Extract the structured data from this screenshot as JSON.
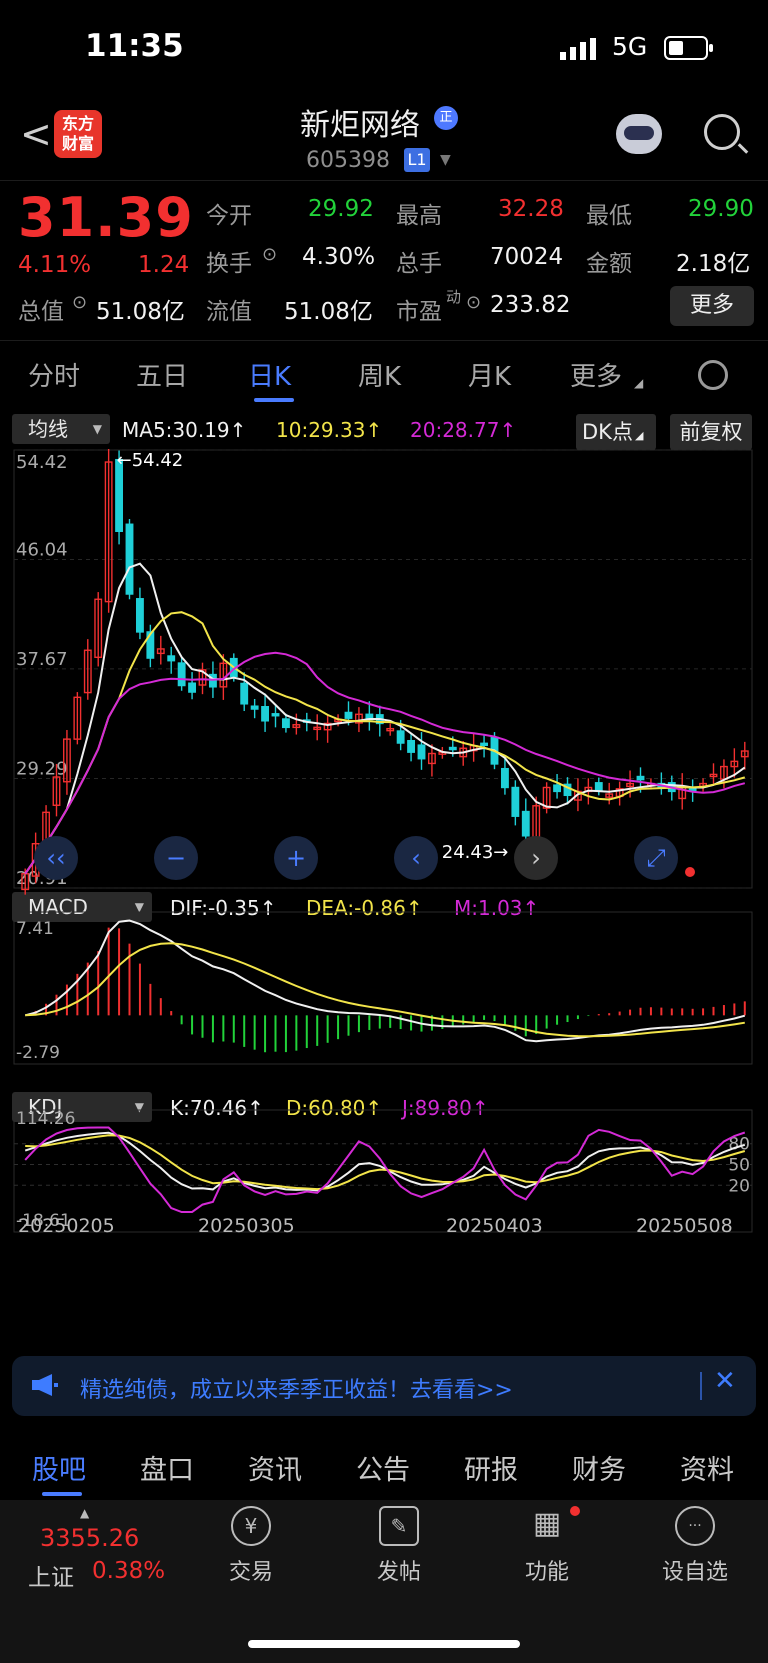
{
  "status_bar": {
    "time": "11:35",
    "network": "5G"
  },
  "header": {
    "logo_text_line1": "东方",
    "logo_text_line2": "财富",
    "stock_name": "新炬网络",
    "badge": "正",
    "stock_code": "605398",
    "level": "L1"
  },
  "quote": {
    "price": "31.39",
    "change_pct": "4.11%",
    "change_abs": "1.24",
    "fields": [
      {
        "label": "今开",
        "value": "29.92",
        "color": "green"
      },
      {
        "label": "最高",
        "value": "32.28",
        "color": "red"
      },
      {
        "label": "最低",
        "value": "29.90",
        "color": "green"
      },
      {
        "label": "换手",
        "value": "4.30%",
        "color": "white"
      },
      {
        "label": "总手",
        "value": "70024",
        "color": "white"
      },
      {
        "label": "金额",
        "value": "2.18亿",
        "color": "white"
      },
      {
        "label": "总值",
        "value": "51.08亿",
        "color": "white"
      },
      {
        "label": "流值",
        "value": "51.08亿",
        "color": "white"
      },
      {
        "label": "市盈",
        "value": "233.82",
        "color": "white"
      }
    ],
    "pe_superscript": "动",
    "more_label": "更多"
  },
  "period_tabs": [
    "分时",
    "五日",
    "日K",
    "周K",
    "月K",
    "更多"
  ],
  "active_period": "日K",
  "indicators": {
    "main_select": "均线",
    "ma5": "MA5:30.19↑",
    "ma10": "10:29.33↑",
    "ma20": "20:28.77↑",
    "dk_label": "DK点",
    "adjust_label": "前复权",
    "macd_select": "MACD",
    "dif": "DIF:-0.35↑",
    "dea": "DEA:-0.86↑",
    "m": "M:1.03↑",
    "kdj_select": "KDJ",
    "k": "K:70.46↑",
    "d": "D:60.80↑",
    "j": "J:89.80↑"
  },
  "colors": {
    "up": "#f23030",
    "down": "#1fd0d8",
    "ma5": "#f0f0f0",
    "ma10": "#f2e44a",
    "ma20": "#d42ad6",
    "accent": "#4a7cff"
  },
  "chart_data": {
    "type": "candlestick",
    "price_axis_labels": [
      "54.42",
      "46.04",
      "37.67",
      "29.29",
      "20.91"
    ],
    "ylim": [
      20.91,
      54.42
    ],
    "high_marker": "←54.42",
    "low_marker": "24.43→",
    "date_labels": [
      "20250205",
      "20250305",
      "20250403",
      "20250508"
    ],
    "closes": [
      22.0,
      24.3,
      26.7,
      29.4,
      32.3,
      35.5,
      39.1,
      43.0,
      53.5,
      48.2,
      43.4,
      40.5,
      38.5,
      39.2,
      38.3,
      36.4,
      35.9,
      37.6,
      36.3,
      38.1,
      37.1,
      35.0,
      34.6,
      33.7,
      34.2,
      33.2,
      33.4,
      33.6,
      33.2,
      33.5,
      33.8,
      33.9,
      34.2,
      33.8,
      33.5,
      33.1,
      32.0,
      31.3,
      30.8,
      31.2,
      31.3,
      31.5,
      31.6,
      31.8,
      31.9,
      30.4,
      28.6,
      26.4,
      24.9,
      27.2,
      28.6,
      28.3,
      28.0,
      28.3,
      28.6,
      28.4,
      28.1,
      28.5,
      28.9,
      29.2,
      28.9,
      28.6,
      28.3,
      28.7,
      28.5,
      28.9,
      29.6,
      30.2,
      30.6,
      31.39
    ],
    "macd": {
      "ylim_labels": [
        "7.41",
        "-2.79"
      ],
      "dif_last": -0.35,
      "dea_last": -0.86,
      "m_last": 1.03
    },
    "kdj": {
      "ylim_labels": [
        "114.26",
        "-18.61"
      ],
      "levels": [
        "80",
        "50",
        "20"
      ],
      "k_last": 70.46,
      "d_last": 60.8,
      "j_last": 89.8
    }
  },
  "ad": {
    "text": "精选纯债，成立以来季季正收益！去看看>>"
  },
  "bottom_tabs": [
    "股吧",
    "盘口",
    "资讯",
    "公告",
    "研报",
    "财务",
    "资料"
  ],
  "active_bottom_tab": "股吧",
  "footer": {
    "index_value": "3355.26",
    "index_name": "上证",
    "index_pct": "0.38%",
    "items": [
      {
        "label": "交易",
        "icon": "yen-icon",
        "glyph": "¥"
      },
      {
        "label": "发帖",
        "icon": "edit-icon",
        "glyph": "✎"
      },
      {
        "label": "功能",
        "icon": "grid-icon",
        "glyph": "▦"
      },
      {
        "label": "设自选",
        "icon": "more-icon",
        "glyph": "···"
      }
    ]
  }
}
